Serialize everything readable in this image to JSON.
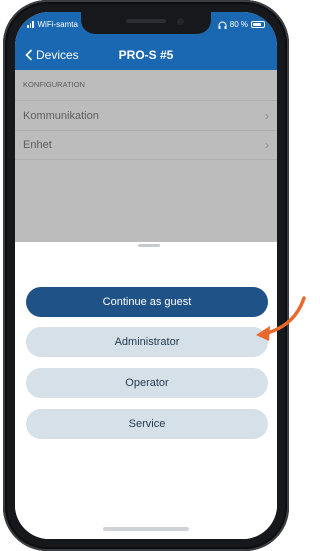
{
  "status": {
    "carrier": "WiFi-samta",
    "battery": "80 %",
    "headphones_icon": "headphones-icon"
  },
  "nav": {
    "back_label": "Devices",
    "title": "PRO-S #5"
  },
  "settings": {
    "section_title": "KONFIGURATION",
    "items": [
      {
        "label": "Kommunikation"
      },
      {
        "label": "Enhet"
      }
    ]
  },
  "login": {
    "guest_label": "Continue as guest",
    "roles": [
      {
        "label": "Administrator"
      },
      {
        "label": "Operator"
      },
      {
        "label": "Service"
      }
    ]
  },
  "colors": {
    "nav_bar": "#1b68b2",
    "primary_button": "#1f5286",
    "secondary_button": "#d6e0e9",
    "annotation_arrow": "#e8692b"
  }
}
